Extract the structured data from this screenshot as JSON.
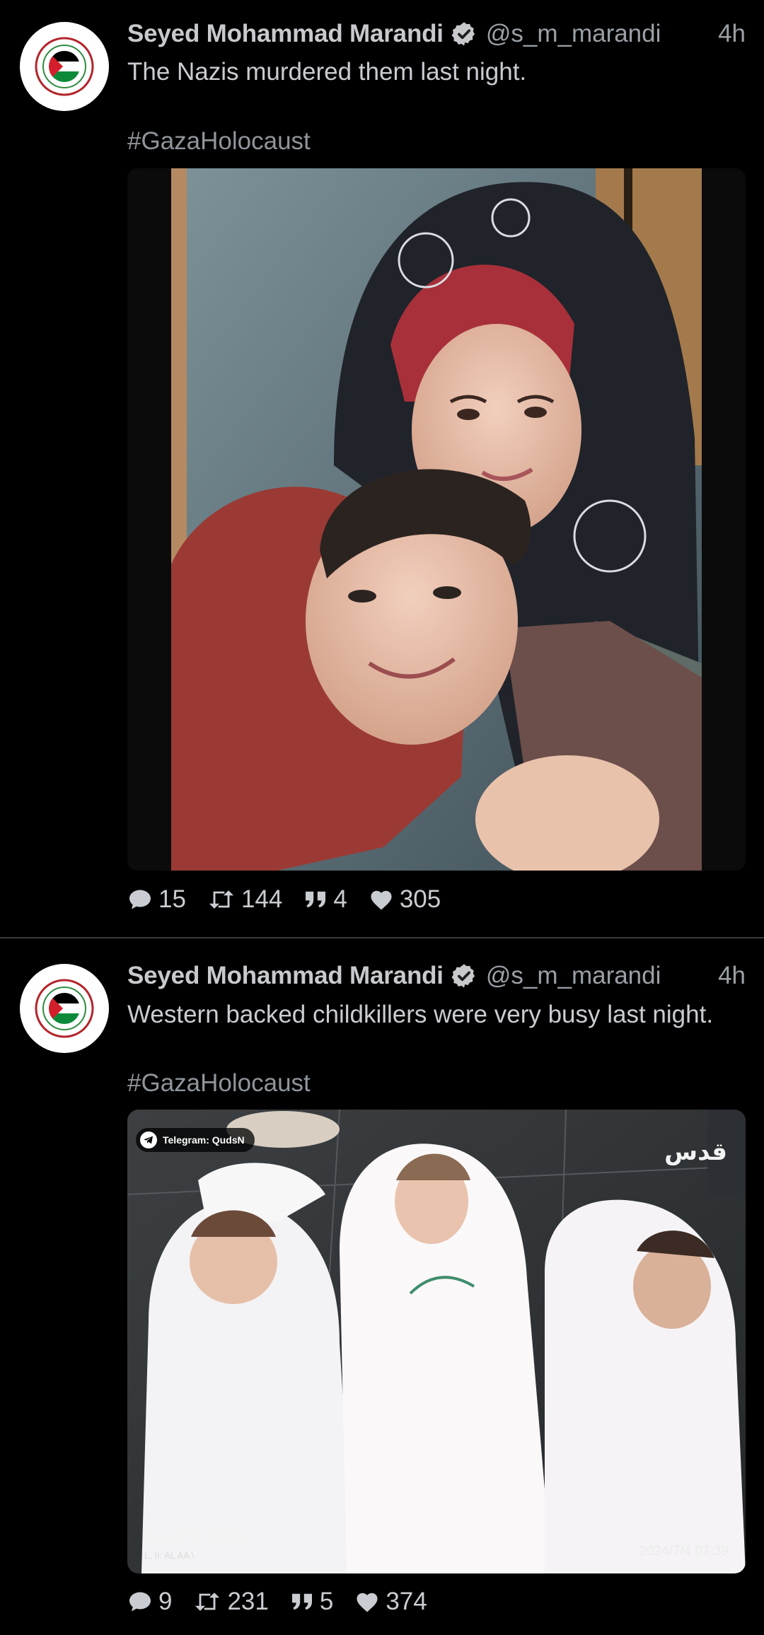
{
  "posts": [
    {
      "author": "Seyed Mohammad Marandi",
      "handle": "@s_m_marandi",
      "time": "4h",
      "text": "The Nazis murdered them last night.",
      "hashtag": "#GazaHolocaust",
      "avatar_icon": "save-gaza-logo",
      "stats": {
        "replies": "15",
        "reposts": "144",
        "quotes": "4",
        "likes": "305"
      }
    },
    {
      "author": "Seyed Mohammad Marandi",
      "handle": "@s_m_marandi",
      "time": "4h",
      "text": "Western backed childkillers were very busy last night.",
      "hashtag": "#GazaHolocaust",
      "avatar_icon": "save-gaza-logo",
      "media_overlay": {
        "telegram": "Telegram: QudsN",
        "brand": "قدس",
        "camera": "POCOPHONE",
        "camera_sub": "L, II: AL AA \\",
        "timestamp": "2024/7/4 07:39"
      },
      "stats": {
        "replies": "9",
        "reposts": "231",
        "quotes": "5",
        "likes": "374"
      }
    }
  ],
  "colors": {
    "background": "#000000",
    "text": "#c9ccd0",
    "muted": "#9aa0a6",
    "verified": "#c7c9cc"
  }
}
